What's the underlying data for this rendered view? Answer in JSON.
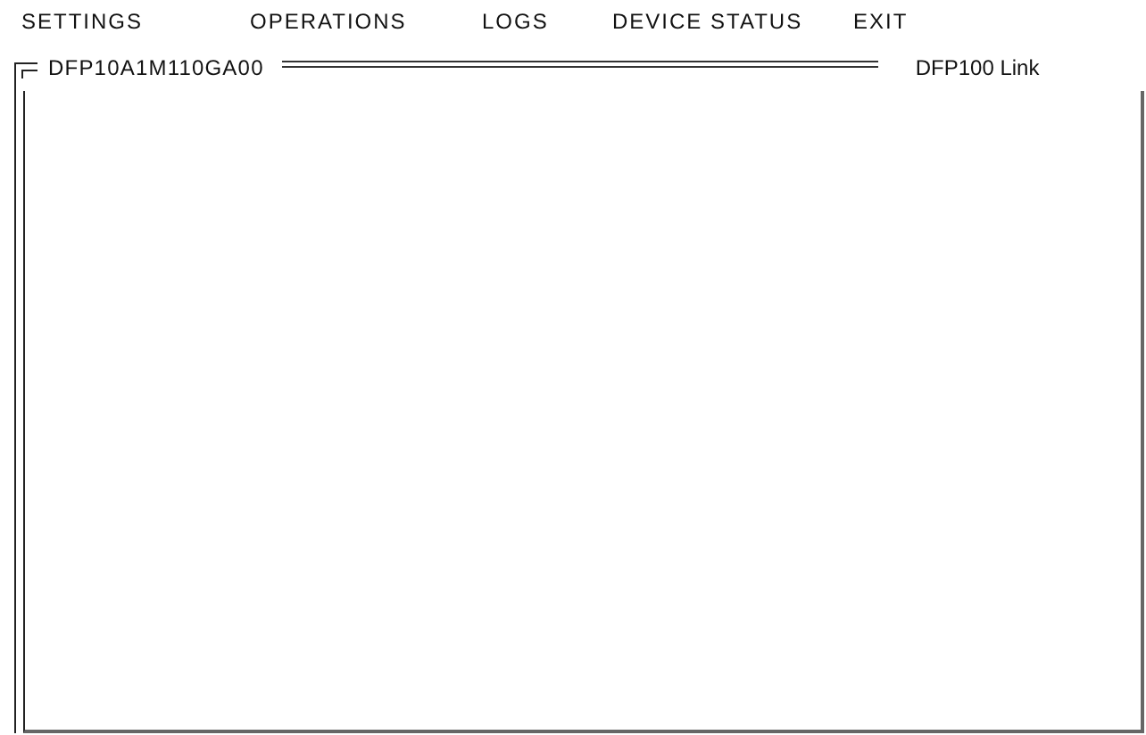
{
  "menu": [
    "SETTINGS",
    "OPERATIONS",
    "LOGS",
    "DEVICE STATUS",
    "EXIT"
  ],
  "panel": {
    "title": "DFP10A1M110GA00",
    "link": "DFP100 Link"
  }
}
